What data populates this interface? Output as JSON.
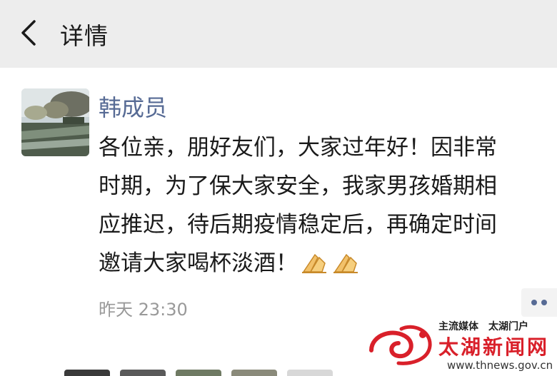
{
  "header": {
    "back_icon": "chevron-left-icon",
    "title": "详情"
  },
  "post": {
    "author": "韩成员",
    "message_lines": [
      "各位亲，朋好友们，大家过年好！因非常",
      "时期，为了保大家安全，我家男孩婚期相",
      "应推迟，待后期疫情稳定后，再确定时间",
      "邀请大家喝杯淡酒！"
    ],
    "emojis": [
      "clasped-hands-icon",
      "clasped-hands-icon"
    ],
    "timestamp": "昨天 23:30",
    "more_icon": "more-dots-icon"
  },
  "watermark": {
    "tagline": "主流媒体　太湖门户",
    "name": "太湖新闻网",
    "url": "www.thnews.gov.cn"
  },
  "colors": {
    "header_bg": "#ededed",
    "author_link": "#576b95",
    "timestamp": "#999999",
    "watermark_red": "#d9202a"
  }
}
